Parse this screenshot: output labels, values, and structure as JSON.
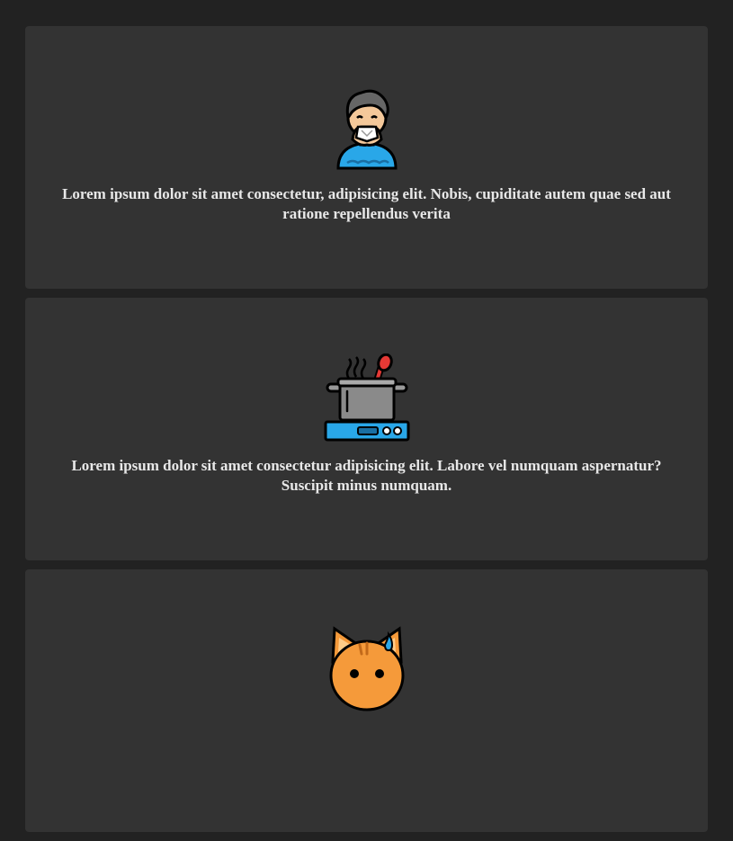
{
  "cards": [
    {
      "icon": "person-sneezing-icon",
      "text": "Lorem ipsum dolor sit amet consectetur, adipisicing elit. Nobis, cupiditate autem quae sed aut ratione repellendus verita"
    },
    {
      "icon": "cooking-pot-on-stove-icon",
      "text": "Lorem ipsum dolor sit amet consectetur adipisicing elit. Labore vel numquam aspernatur? Suscipit minus numquam."
    },
    {
      "icon": "cat-face-sweating-icon",
      "text": ""
    }
  ],
  "colors": {
    "page_background": "#222222",
    "card_background": "#333333",
    "text": "#e8e8e8",
    "accent_blue": "#29a7e8",
    "accent_red": "#e53935",
    "accent_orange": "#f59a3a"
  }
}
